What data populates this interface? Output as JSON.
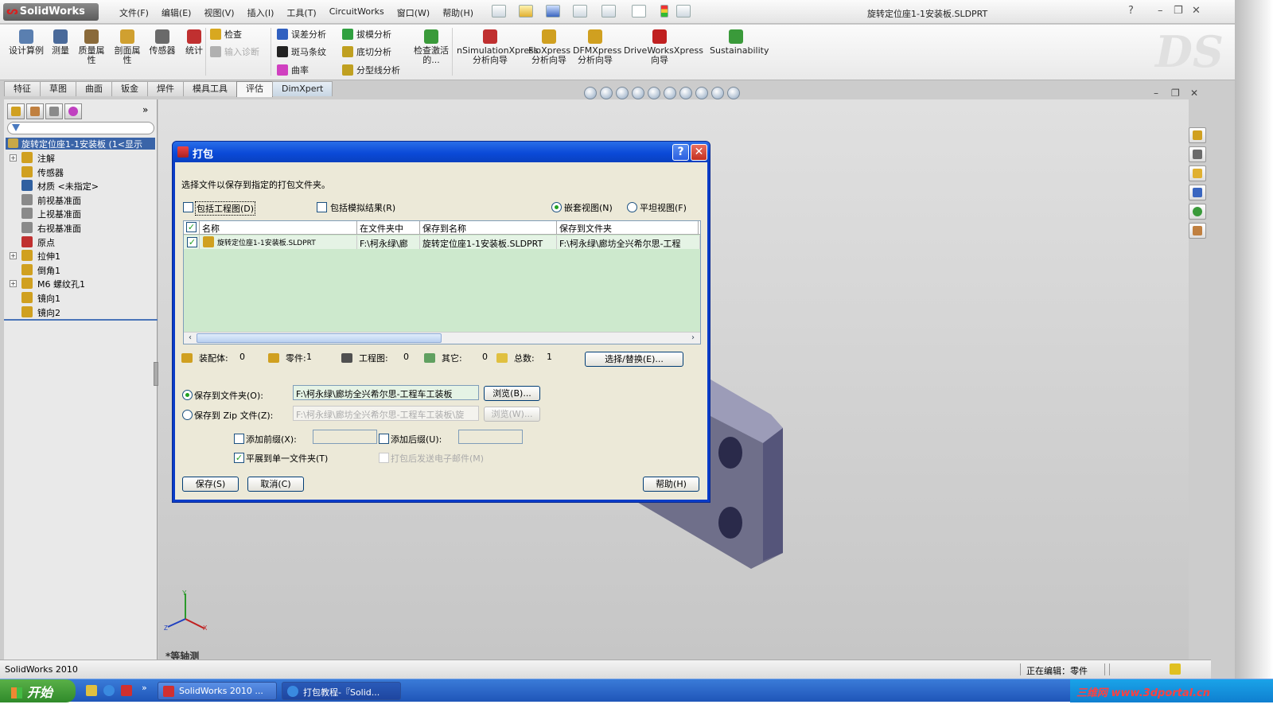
{
  "app": {
    "logo": "SolidWorks",
    "doc_title": "旋转定位座1-1安装板.SLDPRT"
  },
  "menus": [
    "文件(F)",
    "编辑(E)",
    "视图(V)",
    "插入(I)",
    "工具(T)",
    "CircuitWorks",
    "窗口(W)",
    "帮助(H)"
  ],
  "window_controls": [
    "?",
    "–",
    "❐",
    "✕"
  ],
  "ribbon": {
    "large": [
      {
        "label": "设计算例",
        "color": "#5a7fb0"
      },
      {
        "label": "测量",
        "color": "#4a6a9a"
      },
      {
        "label": "质量属性",
        "color": "#8a6a3a"
      },
      {
        "label": "剖面属性",
        "color": "#d0a030"
      },
      {
        "label": "传感器",
        "color": "#6a6a6a"
      },
      {
        "label": "统计",
        "color": "#c03030"
      }
    ],
    "small_col1": [
      {
        "label": "检查",
        "color": "#d8a820"
      },
      {
        "label": "输入诊断",
        "color": "#b0b0b0"
      }
    ],
    "small_col2": [
      {
        "label": "误差分析",
        "color": "#3060c0"
      },
      {
        "label": "斑马条纹",
        "color": "#222222"
      },
      {
        "label": "曲率",
        "color": "#d040c0"
      }
    ],
    "small_col3": [
      {
        "label": "拔模分析",
        "color": "#30a040"
      },
      {
        "label": "底切分析",
        "color": "#c0a020"
      },
      {
        "label": "分型线分析",
        "color": "#c0a020"
      }
    ],
    "check_active": "检查激活的...",
    "xpress": [
      {
        "label": "nSimulationXpress分析向导",
        "color": "#c03030"
      },
      {
        "label": "FloXpress分析向导",
        "color": "#d0a020"
      },
      {
        "label": "DFMXpress分析向导",
        "color": "#d0a020"
      },
      {
        "label": "DriveWorksXpress向导",
        "color": "#c02020"
      },
      {
        "label": "Sustainability",
        "color": "#3a9a3a"
      }
    ]
  },
  "tabs": [
    "特征",
    "草图",
    "曲面",
    "钣金",
    "焊件",
    "模具工具",
    "评估",
    "DimXpert"
  ],
  "active_tab": "评估",
  "feature_tree": {
    "root": "旋转定位座1-1安装板  (1<显示",
    "items": [
      {
        "label": "注解",
        "expand": "+",
        "icon": "#d0a020"
      },
      {
        "label": "传感器",
        "expand": "",
        "icon": "#d0a020"
      },
      {
        "label": "材质 <未指定>",
        "expand": "",
        "icon": "#3060a0"
      },
      {
        "label": "前视基准面",
        "expand": "",
        "icon": "#8a8a8a"
      },
      {
        "label": "上视基准面",
        "expand": "",
        "icon": "#8a8a8a"
      },
      {
        "label": "右视基准面",
        "expand": "",
        "icon": "#8a8a8a"
      },
      {
        "label": "原点",
        "expand": "",
        "icon": "#c03030"
      },
      {
        "label": "拉伸1",
        "expand": "+",
        "icon": "#d0a020"
      },
      {
        "label": "倒角1",
        "expand": "",
        "icon": "#d0a020"
      },
      {
        "label": "M6 螺纹孔1",
        "expand": "+",
        "icon": "#d0a020"
      },
      {
        "label": "镜向1",
        "expand": "",
        "icon": "#d0a020"
      },
      {
        "label": "镜向2",
        "expand": "",
        "icon": "#d0a020"
      }
    ]
  },
  "viewport": {
    "view_name": "*等轴测"
  },
  "dialog": {
    "title": "打包",
    "instruction": "选择文件以保存到指定的打包文件夹。",
    "include_drawings": "包括工程图(D)",
    "include_sim": "包括模拟结果(R)",
    "nested_view": "嵌套视图(N)",
    "flat_view": "平坦视图(F)",
    "columns": [
      "名称",
      "在文件夹中",
      "保存到名称",
      "保存到文件夹"
    ],
    "rows": [
      {
        "name": "旋转定位座1-1安装板.SLDPRT",
        "in_folder": "F:\\柯永绿\\廊",
        "save_name": "旋转定位座1-1安装板.SLDPRT",
        "save_folder": "F:\\柯永绿\\廊坊全兴希尔思-工程"
      }
    ],
    "stats": [
      {
        "label": "装配体:",
        "value": "0",
        "color": "#d0a020"
      },
      {
        "label": "零件:",
        "value": "1",
        "color": "#d0a020"
      },
      {
        "label": "工程图:",
        "value": "0",
        "color": "#505050"
      },
      {
        "label": "其它:",
        "value": "0",
        "color": "#60a060"
      },
      {
        "label": "总数:",
        "value": "1",
        "color": "#e0c040"
      }
    ],
    "select_replace": "选择/替换(E)...",
    "save_to_folder_label": "保存到文件夹(O):",
    "save_to_folder_value": "F:\\柯永绿\\廊坊全兴希尔思-工程车工装板",
    "browse1": "浏览(B)...",
    "save_to_zip_label": "保存到 Zip 文件(Z):",
    "save_to_zip_value": "F:\\柯永绿\\廊坊全兴希尔思-工程车工装板\\旋",
    "browse2": "浏览(W)...",
    "add_prefix": "添加前缀(X):",
    "add_suffix": "添加后缀(U):",
    "flatten": "平展到单一文件夹(T)",
    "email": "打包后发送电子邮件(M)",
    "save_btn": "保存(S)",
    "cancel_btn": "取消(C)",
    "help_btn": "帮助(H)"
  },
  "status": {
    "left": "SolidWorks 2010",
    "right": "正在编辑：零件"
  },
  "taskbar": {
    "start": "开始",
    "buttons": [
      "SolidWorks 2010 ...",
      "打包教程-『Solid..."
    ],
    "tray": "三维网 www.3dportal.cn"
  }
}
